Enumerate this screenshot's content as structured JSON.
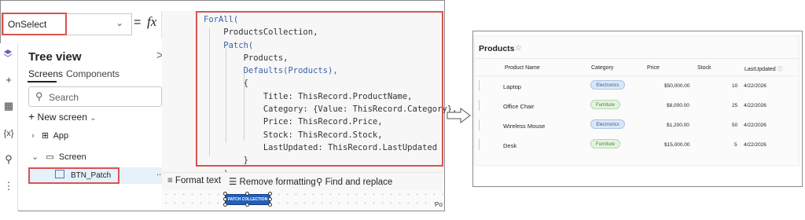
{
  "formula_bar": {
    "property": "OnSelect",
    "equals": "=",
    "fx": "fx"
  },
  "code_lines": [
    "ForAll(",
    "    ProductsCollection,",
    "    Patch(",
    "        Products,",
    "        Defaults(Products),",
    "        {",
    "            Title: ThisRecord.ProductName,",
    "            Category: {Value: ThisRecord.Category},",
    "            Price: ThisRecord.Price,",
    "            Stock: ThisRecord.Stock,",
    "            LastUpdated: ThisRecord.LastUpdated",
    "        }",
    "    )",
    ")"
  ],
  "tree": {
    "title": "Tree view",
    "close": ">",
    "tab_screens": "Screens",
    "tab_components": "Components",
    "search_placeholder": "Search",
    "new_screen": "New screen",
    "app_label": "App",
    "screen_label": "Screen",
    "button_label": "BTN_Patch",
    "more": "..."
  },
  "toolbar": {
    "format_text": "Format text",
    "remove_formatting": "Remove formatting",
    "find_replace": "Find and replace"
  },
  "canvas": {
    "button_text": "PATCH COLLECTION",
    "corner_text": "Po"
  },
  "products": {
    "title": "Products",
    "columns": [
      "Product Name",
      "Category",
      "Price",
      "Stock",
      "LastUpdated"
    ],
    "rows": [
      {
        "name": "Laptop",
        "category": "Electronics",
        "price": "$50,000.00",
        "stock": "10",
        "updated": "4/22/2026"
      },
      {
        "name": "Office Chair",
        "category": "Furniture",
        "price": "$8,000.00",
        "stock": "25",
        "updated": "4/22/2026"
      },
      {
        "name": "Wireless Mouse",
        "category": "Electronics",
        "price": "$1,200.00",
        "stock": "50",
        "updated": "4/22/2026"
      },
      {
        "name": "Desk",
        "category": "Furniture",
        "price": "$15,000.00",
        "stock": "5",
        "updated": "4/22/2026"
      }
    ]
  },
  "colors": {
    "highlight_red": "#d9534f",
    "button_blue": "#1f5fbf",
    "electronics_badge": "#dbe7f6",
    "furniture_badge": "#e3f3df"
  }
}
